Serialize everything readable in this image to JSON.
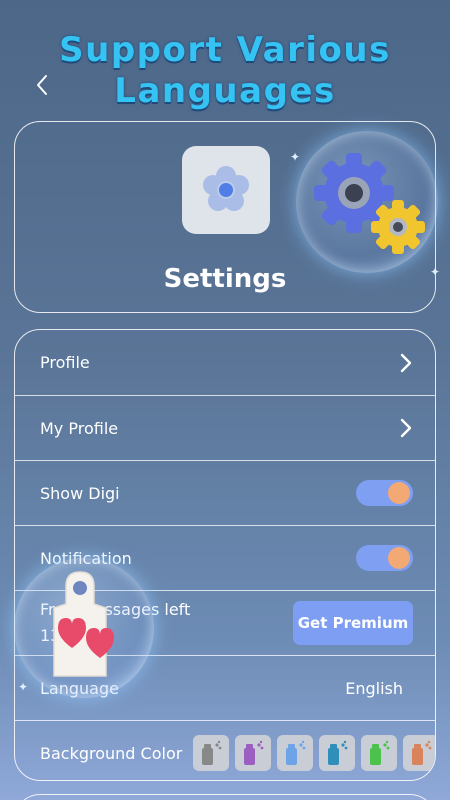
{
  "banner": {
    "line1": "Support Various",
    "line2": "Languages"
  },
  "header": {
    "title": "Settings"
  },
  "rows": {
    "profile": "Profile",
    "my_profile": "My Profile",
    "show_digi": {
      "label": "Show Digi",
      "on": true
    },
    "notification": {
      "label": "Notification",
      "on": true
    },
    "free_messages": {
      "label": "Free messages left",
      "count": "13",
      "button": "Get Premium"
    },
    "language": {
      "label": "Language",
      "value": "English"
    },
    "background_color": {
      "label": "Background Color",
      "swatches": [
        "#888888",
        "#9b5fc0",
        "#6fa3e8",
        "#2f8fb8",
        "#4cc24c",
        "#d9835a"
      ]
    }
  },
  "icons": {
    "back": "chevron-left-icon",
    "app": "flower-icon",
    "gears": "gears-bubble-icon",
    "tag": "door-hanger-hearts-icon"
  },
  "colors": {
    "accent": "#7d9ef3",
    "knob": "#f2a974",
    "banner": "#35c3f3"
  }
}
